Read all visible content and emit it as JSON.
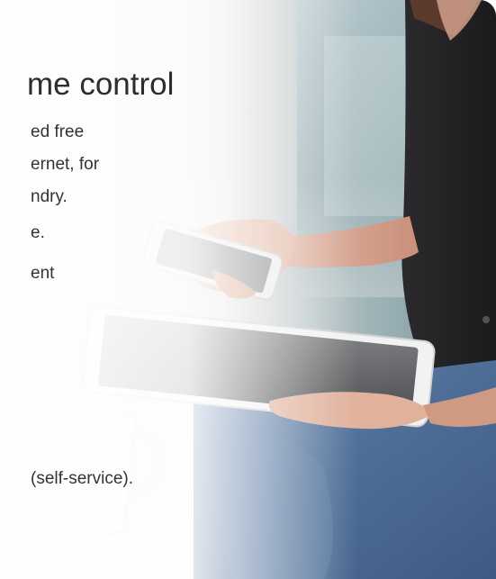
{
  "hero": {
    "headline": "me control",
    "lines": [
      "ed free",
      "ernet, for",
      "ndry.",
      "e.",
      "ent",
      " (self-service)."
    ]
  },
  "colors": {
    "text": "#333333",
    "headline": "#2d2d2d",
    "fade": "#ffffff"
  },
  "icons": {
    "photo": "woman-holding-phone-and-tablet-photo"
  }
}
